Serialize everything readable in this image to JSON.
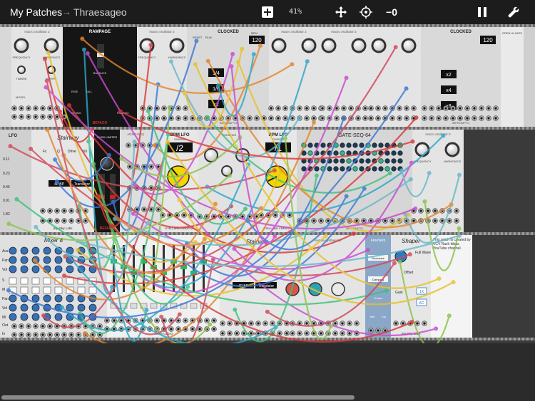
{
  "topbar": {
    "home_label": "My Patches",
    "separator": "→",
    "patch_name": "Thraesageo",
    "zoom_level": "41%",
    "cable_opacity_label": "−0"
  },
  "icons": [
    "plus-icon",
    "move-icon",
    "crosshair-icon",
    "pause-icon",
    "wrench-icon"
  ],
  "modules_row1": {
    "rampage": {
      "title": "RAMPAGE",
      "brand": "BEFACO",
      "labels": [
        "RISE",
        "FALL",
        "BALANCE",
        "RISING",
        "FALLING",
        "OUT"
      ]
    },
    "macro_oscillator_1": {
      "title": "macro oscillator 2",
      "labels": [
        "FREQUENCY",
        "HARMONICS",
        "TIMBRE",
        "MORPH",
        "MODEL",
        "LEVEL",
        "NOTE",
        "HARMO",
        "OUT",
        "AUX"
      ]
    },
    "macro_oscillator_2": {
      "title": "macro oscillator 2",
      "labels": [
        "FREQUENCY",
        "HARMONICS",
        "TIMBRE",
        "MORPH",
        "MODEL",
        "OUT"
      ]
    },
    "clocked_1": {
      "title": "CLOCKED",
      "bpm": "120",
      "labels": [
        "RESET",
        "RUN",
        "BPM",
        "RATIO",
        "SWING",
        "DELAY"
      ],
      "ratios": [
        "1/4",
        "1/6",
        "x2"
      ],
      "brand": "IMPROMPTU"
    },
    "macro_oscillator_3": {
      "title": "macro oscillator 2",
      "labels": [
        "FREQUENCY",
        "HARMONICS",
        "TIMBRE",
        "MORPH",
        "MODEL",
        "OUT"
      ]
    },
    "macro_oscillator_4": {
      "title": "macro oscillator 2",
      "labels": [
        "FREQUENCY",
        "HARMONICS",
        "TIMBRE",
        "MORPH",
        "MODEL",
        "OUT"
      ]
    },
    "clocked_2": {
      "title": "CLOCKED",
      "bpm": "120",
      "labels": [
        "RESET",
        "RUN",
        "BPM",
        "MODE",
        "RATIO",
        "SWING 1",
        "SWING 2",
        "SWING 3",
        "PW 1",
        "PW 2",
        "PW 3",
        "DELAY 1",
        "DELAY 2",
        "DELAY 3"
      ],
      "ratios": [
        "x2",
        "x4",
        "x8"
      ],
      "brand": "IMPROMPTU"
    },
    "hats": {
      "title": "OPEN HI HATS",
      "labels": [
        "CLOCK",
        "HIT",
        "MINI",
        "PORT",
        "DECAY",
        "OUT"
      ]
    }
  },
  "modules_row2": {
    "lfo_small": {
      "title": "LFO"
    },
    "stairway_1": {
      "title": "Stairway",
      "labels": [
        "Fc",
        "Q",
        "Drive",
        "Vol",
        "Edge",
        "Caps",
        "Bass",
        "Slope",
        "CV1",
        "CV2",
        "Q",
        "Drive",
        "In",
        "Out L",
        "Out R"
      ],
      "mode_a": "4P BP",
      "mode_b": "Transistor",
      "brand": "Squinky Labs",
      "values": [
        "0.11",
        "0.23",
        "0.46",
        "0.91",
        "1.82"
      ]
    },
    "slew_limiter": {
      "title": "SLEW LIMITER",
      "labels": [
        "SHAPE",
        "RISE",
        "FALL",
        "IN",
        "OUT"
      ],
      "brand": "BEFACO"
    },
    "adsr": {
      "title": "ADSR-SEQ"
    },
    "bpm_lfo_1": {
      "title": "BPM LFO",
      "subtitle": "DIVISION",
      "division": "/2",
      "labels": [
        "CLOCK",
        "RESET",
        "HOLD",
        "OUT"
      ],
      "brand": "STELLARE CREATIVE"
    },
    "texture_sampler": {
      "title": "Unnamed",
      "labels": [
        "POSITION",
        "DENSITY",
        "SIZE",
        "TEXTURE",
        "BLEND",
        "SPREAD",
        "FEEDBACK",
        "REVERB",
        "FREEZE",
        "IN L",
        "IN R",
        "OUT L",
        "OUT R"
      ]
    },
    "bpm_lfo_2": {
      "title": "BPM LFO",
      "subtitle": "DIVISION",
      "division": "/1",
      "labels": [
        "CLOCK",
        "RESET",
        "HOLD",
        "OUT"
      ],
      "brand": "STELLARE CREATIVE"
    },
    "gate_seq": {
      "title": "GATE-SEQ-64",
      "labels": [
        "RESET",
        "RUN",
        "CLOCK",
        "SEQ",
        "LENGTH",
        "COPY",
        "PASTE"
      ],
      "brand": "IMPROMPTU"
    },
    "macro_oscillator_5": {
      "title": "macro oscillator 2",
      "labels": [
        "FREQUENCY",
        "HARMONICS",
        "TIMBRE",
        "MORPH",
        "MODEL",
        "LEVEL",
        "NOTE",
        "HARMO",
        "OUT",
        "AUX"
      ]
    }
  },
  "modules_row3": {
    "mixer_8": {
      "title": "Mixer 8",
      "labels": [
        "Aux",
        "Pan",
        "Vol",
        "S",
        "M",
        "Pan",
        "Vol",
        "MI",
        "Out",
        "In"
      ]
    },
    "bogaudio_mixer": {
      "brand": "BOGAUDIO",
      "labels": [
        "MUTE",
        "MUTE",
        "MUTE",
        "MUTE",
        "MUTE"
      ]
    },
    "stairway_2": {
      "title": "Stairway",
      "labels": [
        "Fc",
        "Q",
        "Drive",
        "Vol",
        "Edge",
        "Caps",
        "Bass",
        "Slope",
        "CV1",
        "CV2",
        "Q",
        "Drive",
        "In",
        "Out L",
        "Out R"
      ],
      "mode_a": "4P BP",
      "mode_b": "Transistor",
      "brand": "Squinky Labs"
    },
    "texture_synth": {
      "title": "texture synthesizer",
      "labels": [
        "FREEZE",
        "POSITION",
        "DENSITY",
        "SIZE",
        "TEXTURE",
        "PITCH",
        "BLEND",
        "SPREAD",
        "FEEDBACK",
        "REVERB",
        "TRIG",
        "V/OCT",
        "IN L",
        "IN R"
      ]
    },
    "freeverb": {
      "title": "FreeVerb",
      "labels": [
        "Roomsize",
        "Damping",
        "Freeze",
        "Wet",
        "Dry"
      ]
    },
    "shaper": {
      "title": "Shaper",
      "labels": [
        "Full Wave",
        "Offset",
        "Gain",
        "1X",
        "AC",
        "Out",
        "In"
      ],
      "brand": "Squinky Labs"
    },
    "notes": {
      "text": "This patch is created by VCV Rack Ideas YouTube channel."
    }
  }
}
